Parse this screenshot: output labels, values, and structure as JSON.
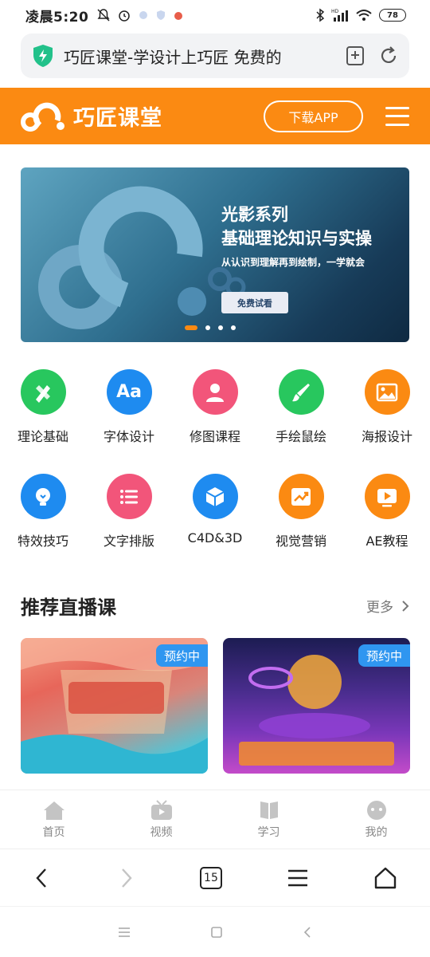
{
  "status_bar": {
    "time": "凌晨5:20",
    "battery": "78",
    "signal_label": "HD"
  },
  "url_bar": {
    "text": "巧匠课堂-学设计上巧匠 免费的"
  },
  "header": {
    "brand": "巧匠课堂",
    "download_label": "下载APP",
    "accent": "#fb8a12"
  },
  "banner": {
    "title_line1": "光影系列",
    "title_line2": "基础理论知识与实操",
    "subtitle": "从认识到理解再到绘制，一学就会",
    "button_label": "免费试看",
    "slide_count": 4,
    "active_slide": 1
  },
  "categories": [
    {
      "label": "理论基础",
      "icon": "pencil-ruler-icon",
      "color": "#28c75e"
    },
    {
      "label": "字体设计",
      "icon": "font-aa-icon",
      "color": "#1e8bf0"
    },
    {
      "label": "修图课程",
      "icon": "user-icon",
      "color": "#f2557a"
    },
    {
      "label": "手绘鼠绘",
      "icon": "brush-icon",
      "color": "#28c75e"
    },
    {
      "label": "海报设计",
      "icon": "image-icon",
      "color": "#fb8a12"
    },
    {
      "label": "特效技巧",
      "icon": "lightbulb-icon",
      "color": "#1e8bf0"
    },
    {
      "label": "文字排版",
      "icon": "list-icon",
      "color": "#f2557a"
    },
    {
      "label": "C4D&3D",
      "icon": "cube-icon",
      "color": "#1e8bf0"
    },
    {
      "label": "视觉营销",
      "icon": "trend-icon",
      "color": "#fb8a12"
    },
    {
      "label": "AE教程",
      "icon": "play-icon",
      "color": "#fb8a12"
    }
  ],
  "section": {
    "title": "推荐直播课",
    "more_label": "更多"
  },
  "live_cards": [
    {
      "badge": "预约中"
    },
    {
      "badge": "预约中"
    }
  ],
  "tab_bar": [
    {
      "label": "首页",
      "icon": "home-icon"
    },
    {
      "label": "视频",
      "icon": "tv-icon"
    },
    {
      "label": "学习",
      "icon": "book-icon"
    },
    {
      "label": "我的",
      "icon": "profile-icon"
    }
  ],
  "browser_bar": {
    "tab_count": "15"
  }
}
